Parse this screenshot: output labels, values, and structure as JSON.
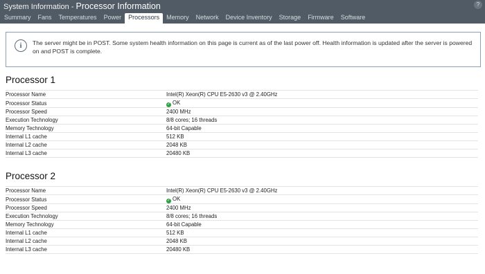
{
  "header": {
    "section": "System Information",
    "separator": " - ",
    "page_title": "Processor Information",
    "help_glyph": "?"
  },
  "tabs": [
    {
      "label": "Summary",
      "active": false
    },
    {
      "label": "Fans",
      "active": false
    },
    {
      "label": "Temperatures",
      "active": false
    },
    {
      "label": "Power",
      "active": false
    },
    {
      "label": "Processors",
      "active": true
    },
    {
      "label": "Memory",
      "active": false
    },
    {
      "label": "Network",
      "active": false
    },
    {
      "label": "Device Inventory",
      "active": false
    },
    {
      "label": "Storage",
      "active": false
    },
    {
      "label": "Firmware",
      "active": false
    },
    {
      "label": "Software",
      "active": false
    }
  ],
  "notice": {
    "icon": "info-icon",
    "text": "The server might be in POST. Some system health information on this page is current as of the last power off. Health information is updated after the server is powered on and POST is complete."
  },
  "processors": [
    {
      "title": "Processor 1",
      "rows": [
        {
          "label": "Processor Name",
          "value": "Intel(R) Xeon(R) CPU E5-2630 v3 @ 2.40GHz"
        },
        {
          "label": "Processor Status",
          "value": "OK",
          "status": true
        },
        {
          "label": "Processor Speed",
          "value": "2400 MHz"
        },
        {
          "label": "Execution Technology",
          "value": "8/8 cores; 16 threads"
        },
        {
          "label": "Memory Technology",
          "value": "64-bit Capable"
        },
        {
          "label": "Internal L1 cache",
          "value": "512 KB"
        },
        {
          "label": "Internal L2 cache",
          "value": "2048 KB"
        },
        {
          "label": "Internal L3 cache",
          "value": "20480 KB"
        }
      ]
    },
    {
      "title": "Processor 2",
      "rows": [
        {
          "label": "Processor Name",
          "value": "Intel(R) Xeon(R) CPU E5-2630 v3 @ 2.40GHz"
        },
        {
          "label": "Processor Status",
          "value": "OK",
          "status": true
        },
        {
          "label": "Processor Speed",
          "value": "2400 MHz"
        },
        {
          "label": "Execution Technology",
          "value": "8/8 cores; 16 threads"
        },
        {
          "label": "Memory Technology",
          "value": "64-bit Capable"
        },
        {
          "label": "Internal L1 cache",
          "value": "512 KB"
        },
        {
          "label": "Internal L2 cache",
          "value": "2048 KB"
        },
        {
          "label": "Internal L3 cache",
          "value": "20480 KB"
        }
      ]
    }
  ],
  "colors": {
    "header_bg": "#505b66",
    "status_ok": "#2ea043",
    "notice_border": "#8ba0b3"
  }
}
